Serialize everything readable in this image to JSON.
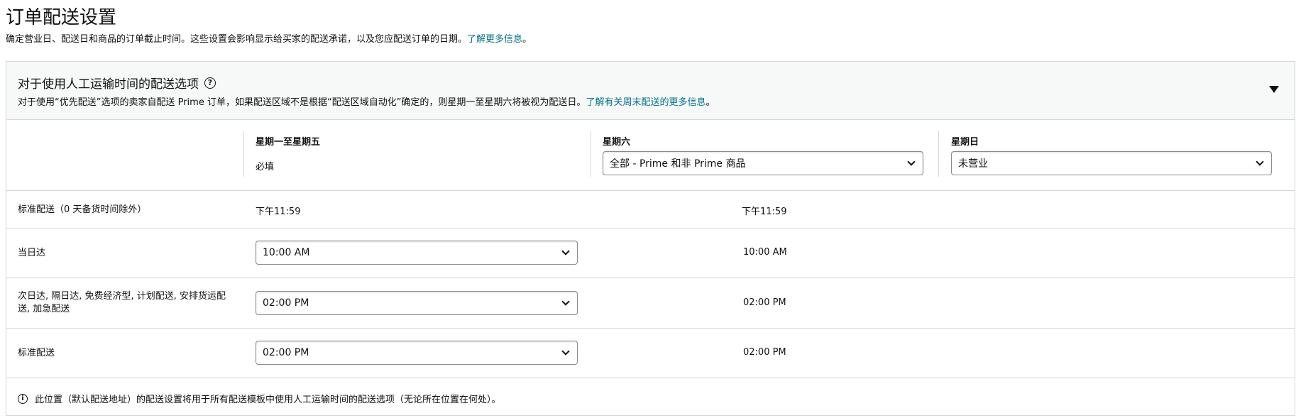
{
  "page": {
    "title": "订单配送设置",
    "description": "确定营业日、配送日和商品的订单截止时间。这些设置会影响显示给买家的配送承诺，以及您应配送订单的日期。",
    "learn_more_link": "了解更多信息",
    "description_end": "。"
  },
  "card": {
    "title": "对于使用人工运输时间的配送选项",
    "help_icon": "question-circle-icon",
    "subtitle": "对于使用“优先配送”选项的卖家自配送 Prime 订单，如果配送区域不是根据“配送区域自动化”确定的，则星期一至星期六将被视为配送日。",
    "subtitle_link": "了解有关周末配送的更多信息",
    "subtitle_end": "。",
    "collapse_icon": "caret-down-icon"
  },
  "columns": {
    "weekday": {
      "label": "星期一至星期五",
      "value": "必填"
    },
    "saturday": {
      "label": "星期六",
      "selected": "全部 - Prime 和非 Prime 商品"
    },
    "sunday": {
      "label": "星期日",
      "selected": "未营业"
    }
  },
  "rows": [
    {
      "label": "标准配送（0 天备货时间除外）",
      "weekday": "下午11:59",
      "saturday": "下午11:59"
    },
    {
      "label": "当日达",
      "weekday": "10:00 AM",
      "saturday": "10:00 AM"
    },
    {
      "label": "次日达, 隔日达, 免费经济型, 计划配送, 安排货运配送, 加急配送",
      "weekday": "02:00 PM",
      "saturday": "02:00 PM"
    },
    {
      "label": "标准配送",
      "weekday": "02:00 PM",
      "saturday": "02:00 PM"
    }
  ],
  "footer": {
    "icon": "info-circle-icon",
    "text": "此位置（默认配送地址）的配送设置将用于所有配送模板中使用人工运输时间的配送选项（无论所在位置在何处）。"
  }
}
